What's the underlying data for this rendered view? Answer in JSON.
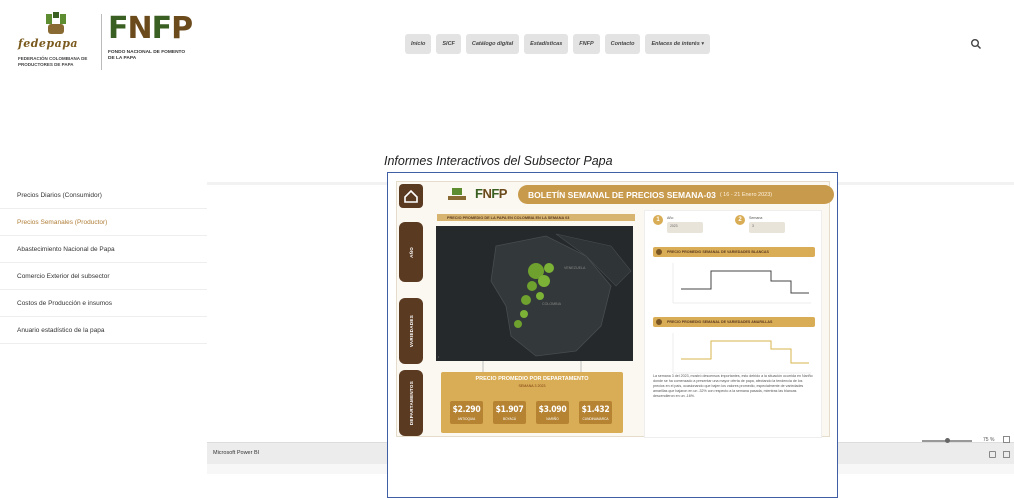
{
  "header": {
    "fede_word": "fedepapa",
    "fede_sub": "FEDERACIÓN COLOMBIANA DE PRODUCTORES DE PAPA",
    "fnfp_word": "FNFP",
    "fnfp_sub": "FONDO NACIONAL DE FOMENTO DE LA PAPA",
    "nav": [
      "Inicio",
      "SICF",
      "Catálogo digital",
      "Estadísticas",
      "FNFP",
      "Contacto",
      "Enlaces de interés ▾"
    ]
  },
  "page_title": "Informes Interactivos del Subsector Papa",
  "sidebar": {
    "items": [
      {
        "label": "Precios Diarios (Consumidor)",
        "active": false
      },
      {
        "label": "Precios Semanales (Productor)",
        "active": true
      },
      {
        "label": "Abastecimiento Nacional de Papa",
        "active": false
      },
      {
        "label": "Comercio Exterior del subsector",
        "active": false
      },
      {
        "label": "Costos de Producción e insumos",
        "active": false
      },
      {
        "label": "Anuario estadístico de la papa",
        "active": false
      }
    ]
  },
  "powerbi": {
    "label": "Microsoft Power BI",
    "zoom": "75 %"
  },
  "report": {
    "banner_title": "BOLETÍN SEMANAL DE PRECIOS SEMANA-03",
    "banner_date": "( 16 - 21 Enero 2023)",
    "rail_tabs": [
      "AÑO",
      "VARIEDADES",
      "DEPARTAMENTOS"
    ],
    "map_title": "PRECIO PROMEDIO DE LA PAPA EN COLOMBIA EN LA SEMANA 03",
    "map_labels": [
      "VENEZUELA",
      "COLOMBIA"
    ],
    "panel_title": "PRECIO PROMEDIO POR DEPARTAMENTO",
    "panel_week": "SEMANA 3 2023",
    "prices": [
      {
        "value": "$2.290",
        "dept": "ANTIOQUIA"
      },
      {
        "value": "$1.907",
        "dept": "BOYACÁ"
      },
      {
        "value": "$3.090",
        "dept": "NARIÑO"
      },
      {
        "value": "$1.432",
        "dept": "CUNDINAMARCA"
      }
    ],
    "selectors": [
      {
        "num": "1",
        "label": "Año",
        "value": "2023"
      },
      {
        "num": "2",
        "label": "Semana",
        "value": "3"
      }
    ],
    "chart1_title": "PRECIO PROMEDIO SEMANAL DE VARIEDADES BLANCAS",
    "chart2_title": "PRECIO PROMEDIO SEMANAL DE VARIEDADES AMARILLAS",
    "paragraph": "La semana 3 del 2023, mostró descensos importantes, esto debido a la situación ocurrida en Nariño donde se ha comenzado a presentar una mayor oferta de papa, afectando la tendencia de los precios en el país, ocasionando que bajen los valores promedio, especialmente de variedades amarillas que bajaron en un -32% con respecto a la semana pasada, mientras las blancas descendieron en un -16%."
  },
  "colors": {
    "accent_gold": "#d9ad55",
    "brown": "#5b3a22",
    "frame_blue": "#3f5ea4",
    "active_link": "#b07e38"
  }
}
